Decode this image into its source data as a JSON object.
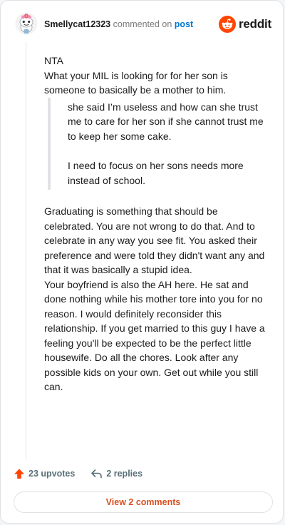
{
  "header": {
    "username": "Smellycat12323",
    "commented_on": "commented on",
    "post_link": "post",
    "logo_text": "reddit"
  },
  "comment": {
    "nta": "NTA",
    "para1": "What your MIL is looking for for her son is someone to basically be a mother to him.",
    "quote1": "she said I’m useless and how can she trust me to care for her son if she cannot trust me to keep her some cake.",
    "quote2": "I need to focus on her sons needs more instead of school.",
    "para2": "Graduating is something that should be celebrated. You are not wrong to do that. And to celebrate in any way you see fit. You asked their preference and were told they didn't want any and that it was basically a stupid idea.",
    "para3": "Your boyfriend is also the AH here. He sat and done nothing while his mother tore into you for no reason. I would definitely reconsider this relationship. If you get married to this guy I have a feeling you'll be expected to be the perfect little housewife. Do all the chores. Look after any possible kids on your own. Get out while you still can."
  },
  "footer": {
    "upvotes": "23 upvotes",
    "replies": "2 replies",
    "view_comments": "View 2 comments"
  },
  "colors": {
    "accent": "#ff4500",
    "link": "#0079d3",
    "view_button": "#d94e1f"
  },
  "icons": {
    "avatar": "snoo-avatar-icon",
    "logo": "reddit-logo-icon",
    "upvote": "upvote-arrow-icon",
    "reply": "reply-arrow-icon"
  }
}
